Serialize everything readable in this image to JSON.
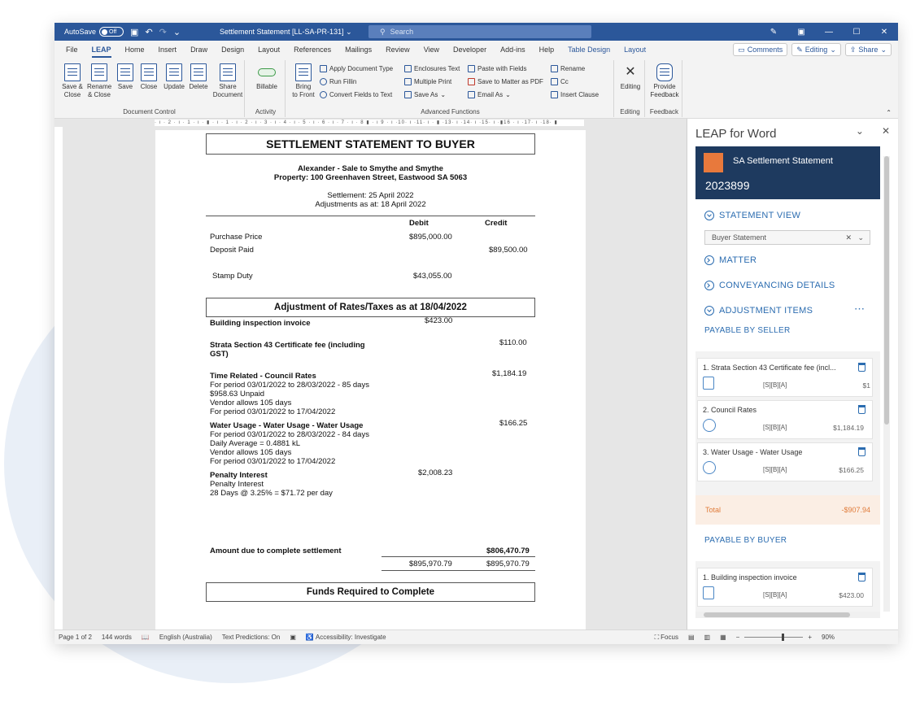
{
  "titlebar": {
    "autosave": "AutoSave",
    "toggle": "Off",
    "doc_title": "Settlement Statement [LL-SA-PR-131]",
    "search": "Search"
  },
  "menu": {
    "tabs": [
      "File",
      "LEAP",
      "Home",
      "Insert",
      "Draw",
      "Design",
      "Layout",
      "References",
      "Mailings",
      "Review",
      "View",
      "Developer",
      "Add-ins",
      "Help",
      "Table Design",
      "Layout"
    ],
    "comments": "Comments",
    "editing": "Editing",
    "share": "Share"
  },
  "ribbon": {
    "doc_control": {
      "label": "Document Control",
      "buttons": [
        "Save &\nClose",
        "Rename\n& Close",
        "Save",
        "Close",
        "Update",
        "Delete",
        "Share\nDocument"
      ]
    },
    "activity": {
      "label": "Activity",
      "billable": "Billable"
    },
    "bring": "Bring\nto Front",
    "advanced": {
      "label": "Advanced Functions",
      "items": [
        "Apply Document Type",
        "Run Fillin",
        "Convert Fields to Text",
        "Enclosures Text",
        "Multiple Print",
        "Save As",
        "Paste with Fields",
        "Save to Matter as PDF",
        "Email As",
        "Rename",
        "Cc",
        "Insert Clause"
      ]
    },
    "editing": {
      "label": "Editing",
      "btn": "Editing"
    },
    "feedback": {
      "label": "Feedback",
      "btn": "Provide\nFeedback"
    }
  },
  "ruler_text": "· ı · 2 · ı · 1 · ı · ▮ · ı · 1 · ı · 2 · ı · 3 · ı · 4 · ı · 5 · ı · 6 · ı · 7 · ı · 8 ▮ · ı 9 · ı ·10· ı ·11· ı · ▮ ·13· ı ·14· ı ·15· ı ·▮16 · ı ·17· ı ·18· ▮",
  "document": {
    "heading": "SETTLEMENT STATEMENT TO BUYER",
    "parties": "Alexander - Sale to Smythe and Smythe",
    "property": "Property: 100 Greenhaven Street, Eastwood SA 5063",
    "settlement": "Settlement: 25 April 2022",
    "adjustments": "Adjustments as at: 18 April 2022",
    "col_debit": "Debit",
    "col_credit": "Credit",
    "purchase_price": "Purchase Price",
    "purchase_price_val": "$895,000.00",
    "deposit": "Deposit Paid",
    "deposit_val": "$89,500.00",
    "stamp": "Stamp Duty",
    "stamp_val": "$43,055.00",
    "adj_heading": "Adjustment of Rates/Taxes as at 18/04/2022",
    "building": "Building inspection invoice",
    "building_val": "$423.00",
    "strata_1": "Strata Section 43 Certificate fee (including",
    "strata_2": "GST)",
    "strata_val": "$110.00",
    "council_title": "Time Related - Council Rates",
    "council_val": "$1,184.19",
    "council_lines": [
      "For period 03/01/2022 to 28/03/2022 - 85 days",
      "$958.63 Unpaid",
      "Vendor allows 105 days",
      "For period 03/01/2022 to 17/04/2022"
    ],
    "water_title": "Water Usage - Water Usage - Water Usage",
    "water_val": "$166.25",
    "water_lines": [
      "For period 03/01/2022 to 28/03/2022 - 84 days",
      "Daily Average = 0.4881 kL",
      "Vendor allows 105 days",
      "For period 03/01/2022 to 17/04/2022"
    ],
    "penalty_title": "Penalty Interest",
    "penalty_val": "$2,008.23",
    "penalty_lines": [
      "Penalty Interest",
      "28 Days @ 3.25% = $71.72 per day"
    ],
    "amount_due": "Amount due to complete settlement",
    "amount_due_val": "$806,470.79",
    "total_debit": "$895,970.79",
    "total_credit": "$895,970.79",
    "funds": "Funds Required to Complete"
  },
  "status": {
    "page": "Page 1 of 2",
    "words": "144 words",
    "lang": "English (Australia)",
    "predictions": "Text Predictions: On",
    "access": "Accessibility: Investigate",
    "focus": "Focus",
    "zoom": "90%"
  },
  "pane": {
    "title": "LEAP for Word",
    "header_title": "SA Settlement Statement",
    "header_num": "2023899",
    "statement_view": "STATEMENT VIEW",
    "select_value": "Buyer Statement",
    "matter": "MATTER",
    "conveyancing": "CONVEYANCING DETAILS",
    "adjustment_items": "ADJUSTMENT ITEMS",
    "payable_seller": "PAYABLE BY SELLER",
    "seller_items": [
      {
        "title": "1. Strata Section 43 Certificate fee (incl...",
        "tag": "[S][B][A]",
        "amount": "$1"
      },
      {
        "title": "2. Council Rates",
        "tag": "[S][B][A]",
        "amount": "$1,184.19"
      },
      {
        "title": "3. Water Usage - Water Usage",
        "tag": "[S][B][A]",
        "amount": "$166.25"
      }
    ],
    "total_label": "Total",
    "total_val": "-$907.94",
    "payable_buyer": "PAYABLE BY BUYER",
    "buyer_items": [
      {
        "title": "1. Building inspection invoice",
        "tag": "[S][B][A]",
        "amount": "$423.00"
      }
    ]
  }
}
